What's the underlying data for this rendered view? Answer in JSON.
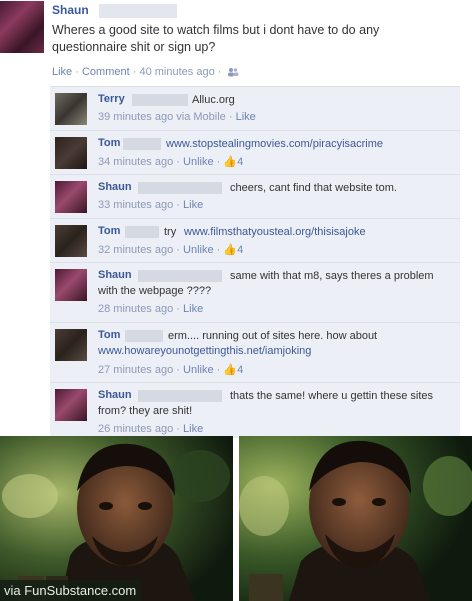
{
  "post": {
    "author": "Shaun",
    "text": "Wheres a good site to watch films but i dont have to do any questionnaire shit or sign up?",
    "actions": {
      "like": "Like",
      "comment": "Comment",
      "time": "40 minutes ago"
    }
  },
  "comments": [
    {
      "name": "Terry",
      "text": "Alluc.org",
      "time": "39 minutes ago via Mobile",
      "action": "Like"
    },
    {
      "name": "Tom",
      "text": "www.stopstealingmovies.com/piracyisacrime",
      "time": "34 minutes ago",
      "action": "Unlike",
      "likes": "4"
    },
    {
      "name": "Shaun",
      "text": "cheers, cant find that website tom.",
      "time": "33 minutes ago",
      "action": "Like"
    },
    {
      "name": "Tom",
      "text_prefix": "try",
      "link": "www.filmsthatyousteal.org/thisisajoke",
      "time": "32 minutes ago",
      "action": "Unlike",
      "likes": "4"
    },
    {
      "name": "Shaun",
      "text_line1": "same with that m8, says theres a problem",
      "text_line2": "with the webpage ????",
      "time": "28 minutes ago",
      "action": "Like"
    },
    {
      "name": "Tom",
      "text_line1": "erm.... running out of sites here. how about",
      "link": "www.howareyounotgettingthis.net/iamjoking",
      "time": "27 minutes ago",
      "action": "Unlike",
      "likes": "4"
    },
    {
      "name": "Shaun",
      "text_line1": "thats the same! where u gettin these sites",
      "text_line2": "from? they are shit!",
      "time": "26 minutes ago",
      "action": "Like"
    }
  ],
  "watermark": "via FunSubstance.com",
  "colors": {
    "name_blue": "#3b5998",
    "meta_gray": "#8c9ab7",
    "comment_bg": "#eceff5"
  }
}
